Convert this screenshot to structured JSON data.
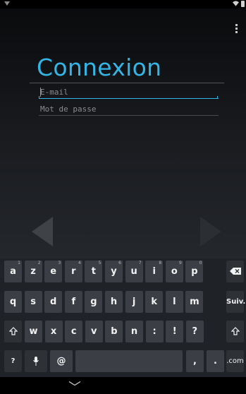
{
  "app": {
    "title": "Connexion"
  },
  "form": {
    "email_placeholder": "E-mail",
    "password_placeholder": "Mot de passe"
  },
  "colors": {
    "accent": "#33b5e5",
    "background": "#000000",
    "key": "#3b3e44"
  },
  "icons": {
    "status_left": "notification-icon",
    "wifi": "wifi-icon",
    "battery": "battery-icon",
    "overflow": "overflow-menu-icon",
    "prev": "arrow-left-icon",
    "next": "arrow-right-icon",
    "backspace": "backspace-icon",
    "shift": "shift-icon",
    "mic": "microphone-icon",
    "hide_keyboard": "chevron-down-icon"
  },
  "keyboard": {
    "row1": [
      {
        "label": "a",
        "hint": "1"
      },
      {
        "label": "z",
        "hint": "2"
      },
      {
        "label": "e",
        "hint": "3"
      },
      {
        "label": "r",
        "hint": "4"
      },
      {
        "label": "t",
        "hint": "5"
      },
      {
        "label": "y",
        "hint": "6"
      },
      {
        "label": "u",
        "hint": "7"
      },
      {
        "label": "i",
        "hint": "8"
      },
      {
        "label": "o",
        "hint": "9"
      },
      {
        "label": "p",
        "hint": "0"
      }
    ],
    "row2": [
      {
        "label": "q"
      },
      {
        "label": "s"
      },
      {
        "label": "d"
      },
      {
        "label": "f"
      },
      {
        "label": "g"
      },
      {
        "label": "h"
      },
      {
        "label": "j"
      },
      {
        "label": "k"
      },
      {
        "label": "l"
      },
      {
        "label": "m"
      }
    ],
    "next_label": "Suiv.",
    "row3": [
      {
        "label": "w"
      },
      {
        "label": "x"
      },
      {
        "label": "c"
      },
      {
        "label": "v"
      },
      {
        "label": "b"
      },
      {
        "label": "n"
      },
      {
        "label": ":"
      },
      {
        "label": "!"
      },
      {
        "label": "?"
      }
    ],
    "symbols_label": "?123",
    "at_label": "@",
    "comma_label": ",",
    "period_label": ".",
    "com_label": ".com"
  }
}
